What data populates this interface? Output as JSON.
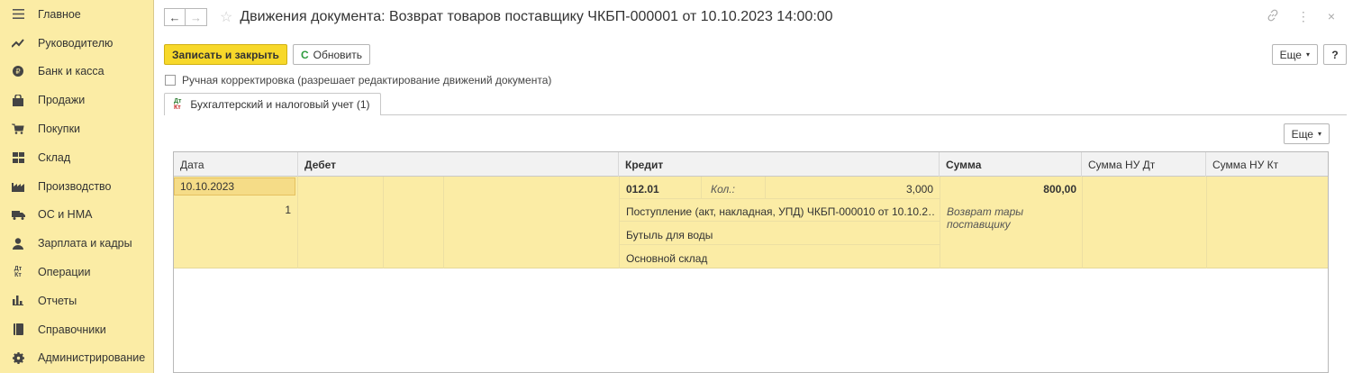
{
  "sidebar": {
    "items": [
      {
        "label": "Главное",
        "icon": "menu-icon"
      },
      {
        "label": "Руководителю",
        "icon": "trend-icon"
      },
      {
        "label": "Банк и касса",
        "icon": "coin-icon"
      },
      {
        "label": "Продажи",
        "icon": "bag-icon"
      },
      {
        "label": "Покупки",
        "icon": "cart-icon"
      },
      {
        "label": "Склад",
        "icon": "warehouse-icon"
      },
      {
        "label": "Производство",
        "icon": "factory-icon"
      },
      {
        "label": "ОС и НМА",
        "icon": "truck-icon"
      },
      {
        "label": "Зарплата и кадры",
        "icon": "person-icon"
      },
      {
        "label": "Операции",
        "icon": "dt-kt-icon"
      },
      {
        "label": "Отчеты",
        "icon": "bar-chart-icon"
      },
      {
        "label": "Справочники",
        "icon": "book-icon"
      },
      {
        "label": "Администрирование",
        "icon": "gear-icon"
      }
    ]
  },
  "header": {
    "title": "Движения документа: Возврат товаров поставщику ЧКБП-000001 от 10.10.2023 14:00:00",
    "back_glyph": "←",
    "forward_glyph": "→",
    "star_glyph": "☆",
    "link_glyph": "🔗",
    "more_glyph": "⋮",
    "close_glyph": "×"
  },
  "toolbar": {
    "save_close_label": "Записать и закрыть",
    "refresh_label": "Обновить",
    "refresh_glyph": "C",
    "more_label": "Еще",
    "help_label": "?"
  },
  "manual": {
    "label": "Ручная корректировка (разрешает редактирование движений документа)",
    "checked": false
  },
  "tab": {
    "label": "Бухгалтерский и налоговый учет (1)",
    "icon_top": "Дт",
    "icon_bottom": "Кт"
  },
  "grid": {
    "more_label": "Еще",
    "columns": [
      "Дата",
      "Дебет",
      "Кредит",
      "Сумма",
      "Сумма НУ Дт",
      "Сумма НУ Кт"
    ],
    "rows": [
      {
        "date": "10.10.2023",
        "number": "1",
        "credit_account": "012.01",
        "qty_label": "Кол.:",
        "qty_value": "3,000",
        "credit_sub1": "Поступление (акт, накладная, УПД) ЧКБП-000010 от 10.10.2…",
        "credit_sub2": "Бутыль для воды",
        "credit_sub3": "Основной склад",
        "amount": "800,00",
        "content": "Возврат тары поставщику"
      }
    ]
  }
}
